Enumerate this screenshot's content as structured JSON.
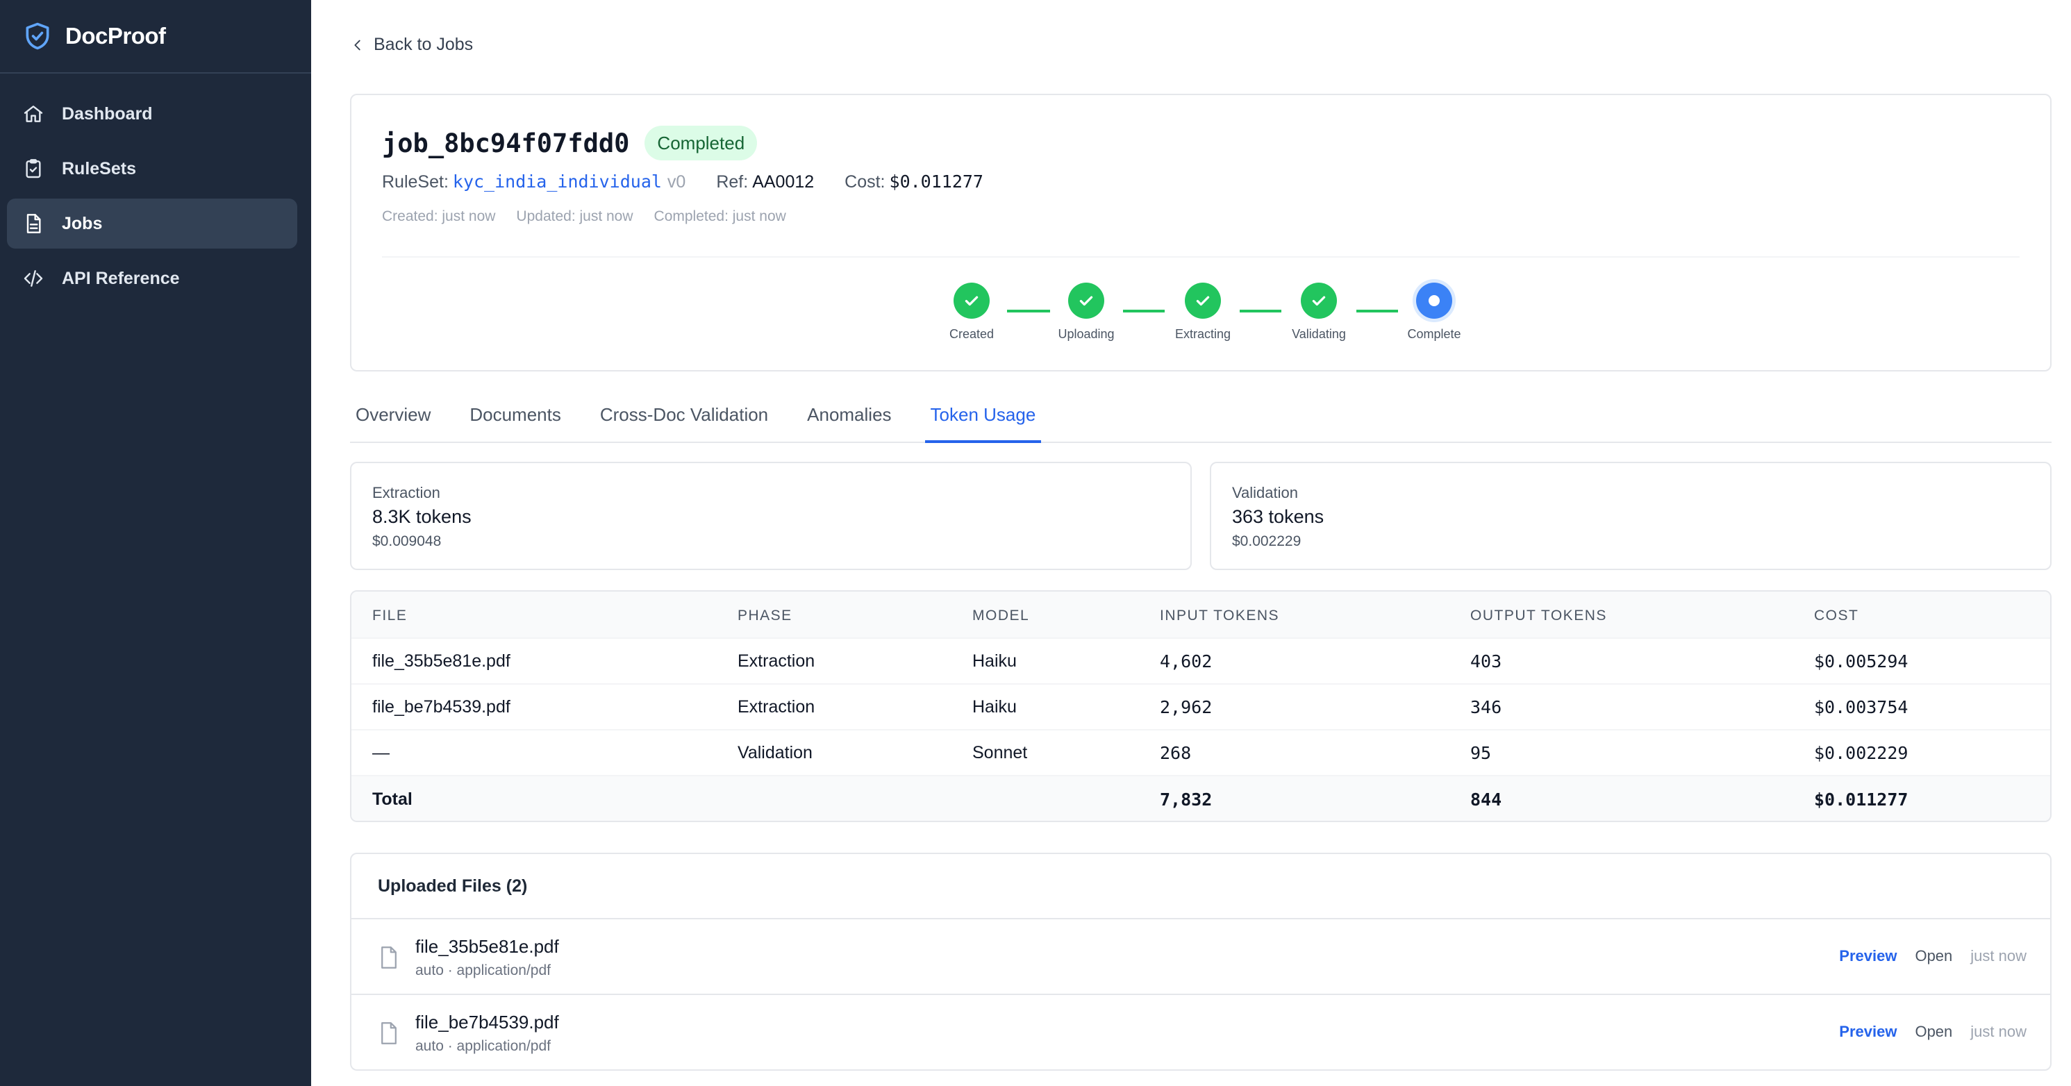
{
  "app": {
    "name": "DocProof"
  },
  "sidebar": {
    "items": [
      {
        "label": "Dashboard",
        "icon": "home-icon"
      },
      {
        "label": "RuleSets",
        "icon": "clipboard-icon"
      },
      {
        "label": "Jobs",
        "icon": "document-icon",
        "active": true
      },
      {
        "label": "API Reference",
        "icon": "code-icon"
      }
    ]
  },
  "back_link": "Back to Jobs",
  "job": {
    "id": "job_8bc94f07fdd0",
    "status": "Completed",
    "ruleset_label": "RuleSet:",
    "ruleset_name": "kyc_india_individual",
    "ruleset_version": "v0",
    "ref_label": "Ref:",
    "ref": "AA0012",
    "cost_label": "Cost:",
    "cost": "$0.011277",
    "created": "Created: just now",
    "updated": "Updated: just now",
    "completed": "Completed: just now"
  },
  "steps": [
    {
      "label": "Created",
      "state": "done"
    },
    {
      "label": "Uploading",
      "state": "done"
    },
    {
      "label": "Extracting",
      "state": "done"
    },
    {
      "label": "Validating",
      "state": "done"
    },
    {
      "label": "Complete",
      "state": "current"
    }
  ],
  "tabs": [
    {
      "label": "Overview"
    },
    {
      "label": "Documents"
    },
    {
      "label": "Cross-Doc Validation"
    },
    {
      "label": "Anomalies"
    },
    {
      "label": "Token Usage",
      "active": true
    }
  ],
  "summary": {
    "extraction": {
      "title": "Extraction",
      "tokens": "8.3K tokens",
      "cost": "$0.009048"
    },
    "validation": {
      "title": "Validation",
      "tokens": "363 tokens",
      "cost": "$0.002229"
    }
  },
  "table": {
    "headers": [
      "FILE",
      "PHASE",
      "MODEL",
      "INPUT TOKENS",
      "OUTPUT TOKENS",
      "COST"
    ],
    "rows": [
      [
        "file_35b5e81e.pdf",
        "Extraction",
        "Haiku",
        "4,602",
        "403",
        "$0.005294"
      ],
      [
        "file_be7b4539.pdf",
        "Extraction",
        "Haiku",
        "2,962",
        "346",
        "$0.003754"
      ],
      [
        "—",
        "Validation",
        "Sonnet",
        "268",
        "95",
        "$0.002229"
      ]
    ],
    "total": {
      "label": "Total",
      "input": "7,832",
      "output": "844",
      "cost": "$0.011277"
    }
  },
  "files": {
    "title": "Uploaded Files (2)",
    "items": [
      {
        "name": "file_35b5e81e.pdf",
        "sub": "auto · application/pdf",
        "preview": "Preview",
        "open": "Open",
        "time": "just now"
      },
      {
        "name": "file_be7b4539.pdf",
        "sub": "auto · application/pdf",
        "preview": "Preview",
        "open": "Open",
        "time": "just now"
      }
    ]
  },
  "colors": {
    "sidebar_bg": "#1e293b",
    "accent": "#2563eb",
    "success": "#22c55e",
    "current_step": "#3b82f6"
  }
}
